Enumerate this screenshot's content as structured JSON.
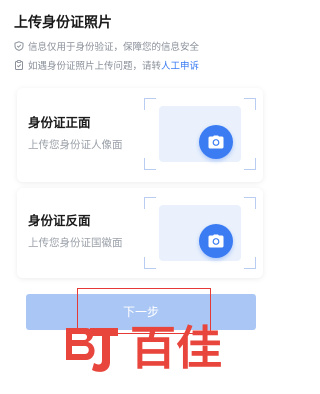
{
  "page": {
    "title": "上传身份证照片"
  },
  "notices": [
    {
      "icon": "shield-icon",
      "text": "信息仅用于身份验证，保障您的信息安全"
    },
    {
      "icon": "clipboard-icon",
      "text_prefix": "如遇身份证照片上传问题，请转",
      "link_text": "人工申诉"
    }
  ],
  "cards": {
    "front": {
      "title": "身份证正面",
      "subtitle": "上传您身份证人像面"
    },
    "back": {
      "title": "身份证反面",
      "subtitle": "上传您身份证国徽面"
    }
  },
  "actions": {
    "next_label": "下一步"
  },
  "watermark": {
    "text": "百佳"
  },
  "colors": {
    "accent": "#3b7cf3",
    "button_disabled": "#a9c6f4",
    "highlight": "#e53935",
    "watermark": "#e8453c"
  }
}
